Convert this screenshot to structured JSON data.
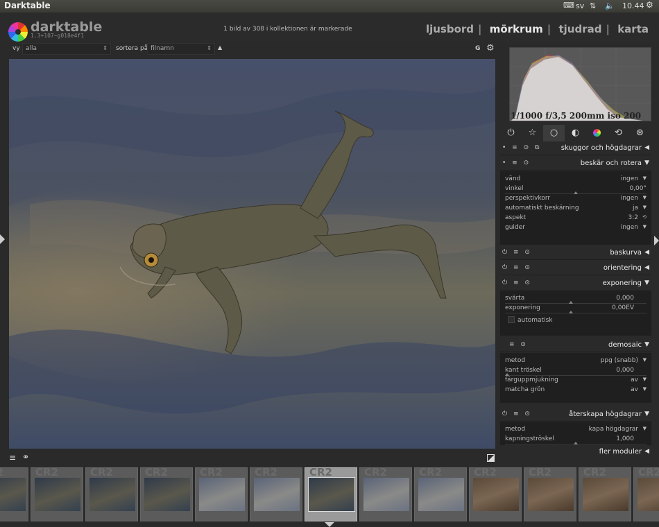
{
  "system": {
    "app_title": "Darktable",
    "keyboard_layout": "sv",
    "clock": "10.44"
  },
  "header": {
    "app_name": "darktable",
    "version": "1.3+107~g018e4f1",
    "status": "1 bild av 308 i kollektionen är markerade",
    "views": [
      {
        "label": "ljusbord",
        "active": false
      },
      {
        "label": "mörkrum",
        "active": true
      },
      {
        "label": "tjudrad",
        "active": false
      },
      {
        "label": "karta",
        "active": false
      }
    ]
  },
  "filter": {
    "view_label": "vy",
    "view_value": "alla",
    "sort_label": "sortera på",
    "sort_value": "filnamn",
    "right_label": "G"
  },
  "histogram": {
    "info": "1/1000 f/3,5 200mm iso 200"
  },
  "modules": {
    "m1": {
      "name": "skuggor och högdagrar",
      "expanded": false
    },
    "m2": {
      "name": "beskär och rotera",
      "expanded": true,
      "params": [
        {
          "label": "vänd",
          "value": "ingen"
        },
        {
          "label": "vinkel",
          "value": "0,00°"
        },
        {
          "label": "perspektivkorr",
          "value": "ingen"
        },
        {
          "label": "automatiskt beskärning",
          "value": "ja"
        },
        {
          "label": "aspekt",
          "value": "3:2"
        },
        {
          "label": "guider",
          "value": "ingen"
        }
      ]
    },
    "m3": {
      "name": "baskurva",
      "expanded": false
    },
    "m4": {
      "name": "orientering",
      "expanded": false
    },
    "m5": {
      "name": "exponering",
      "expanded": true,
      "params": [
        {
          "label": "svärta",
          "value": "0,000"
        },
        {
          "label": "exponering",
          "value": "0,00EV"
        }
      ],
      "checkbox_label": "automatisk"
    },
    "m6": {
      "name": "demosaic",
      "expanded": true,
      "params": [
        {
          "label": "metod",
          "value": "ppg (snabb)"
        },
        {
          "label": "kant tröskel",
          "value": "0,000"
        },
        {
          "label": "färguppmjukning",
          "value": "av"
        },
        {
          "label": "matcha grön",
          "value": "av"
        }
      ]
    },
    "m7": {
      "name": "återskapa högdagrar",
      "expanded": true,
      "params": [
        {
          "label": "metod",
          "value": "kapa högdagrar"
        },
        {
          "label": "kapningströskel",
          "value": "1,000"
        }
      ]
    },
    "more": "fler moduler"
  },
  "filmstrip": {
    "thumbs": [
      {
        "ext": "CR2",
        "selected": false,
        "tone": "water"
      },
      {
        "ext": "CR2",
        "selected": false,
        "tone": "water"
      },
      {
        "ext": "CR2",
        "selected": false,
        "tone": "water"
      },
      {
        "ext": "CR2",
        "selected": false,
        "tone": "water"
      },
      {
        "ext": "CR2",
        "selected": false,
        "tone": "water-light"
      },
      {
        "ext": "CR2",
        "selected": false,
        "tone": "water-light"
      },
      {
        "ext": "CR2",
        "selected": true,
        "tone": "water"
      },
      {
        "ext": "CR2",
        "selected": false,
        "tone": "water-light"
      },
      {
        "ext": "CR2",
        "selected": false,
        "tone": "water-light"
      },
      {
        "ext": "CR2",
        "selected": false,
        "tone": "ground"
      },
      {
        "ext": "CR2",
        "selected": false,
        "tone": "ground"
      },
      {
        "ext": "CR2",
        "selected": false,
        "tone": "ground"
      },
      {
        "ext": "CR2",
        "selected": false,
        "tone": "ground"
      }
    ]
  },
  "colors": {
    "accent_text": "#e6e6e6",
    "panel_bg": "#2a2a2a"
  }
}
